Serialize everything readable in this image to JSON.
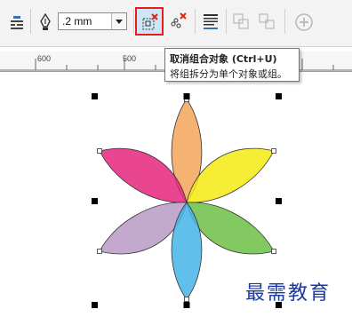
{
  "toolbar": {
    "outline_width": ".2 mm",
    "icons": [
      "wrap-text-icon",
      "pen-nib-icon",
      "ungroup-icon",
      "ungroup-all-icon",
      "text-align-icon",
      "combine-icon",
      "break-apart-icon",
      "add-icon"
    ]
  },
  "ruler": {
    "labels": [
      "600",
      "500"
    ]
  },
  "tooltip": {
    "title": "取消组合对象 (Ctrl+U)",
    "description": "将组拆分为单个对象或组。"
  },
  "watermark": {
    "text": "最需教育"
  },
  "colors": {
    "highlight_border": "#e0201b",
    "petal_orange": "#f5a55a",
    "petal_yellow": "#f5ea14",
    "petal_green": "#6dbf46",
    "petal_blue": "#45b4e8",
    "petal_purple": "#b89ac4",
    "petal_magenta": "#e6257e",
    "watermark": "#1a3aa0"
  }
}
